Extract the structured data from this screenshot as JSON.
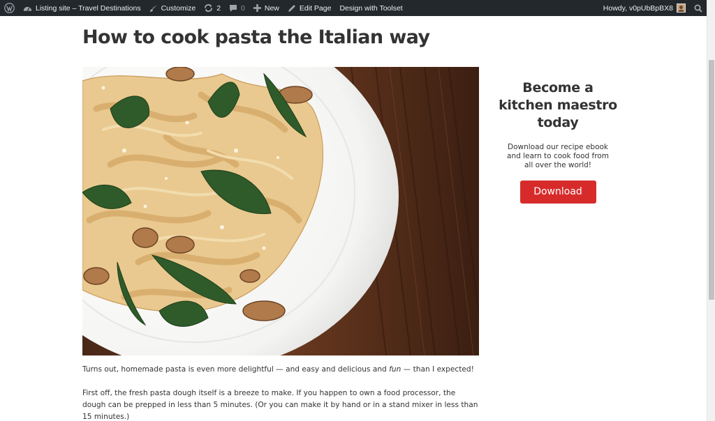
{
  "adminbar": {
    "site_name": "Listing site – Travel Destinations",
    "customize": "Customize",
    "updates_count": "2",
    "comments_count": "0",
    "new_label": "New",
    "edit_page": "Edit Page",
    "toolset": "Design with Toolset",
    "howdy": "Howdy, v0pUbBpBX8"
  },
  "post": {
    "title": "How to cook pasta the Italian way",
    "p1_before": "Turns out, homemade pasta is even more delightful — and easy and delicious and ",
    "p1_em": "fun",
    "p1_after": " — than I expected!",
    "p2": "First off, the fresh pasta dough itself is a breeze to make.  If you happen to own a food processor, the dough can be prepped in less than 5 minutes.  (Or you can make it by hand or in a stand mixer in less than 15 minutes.)"
  },
  "sidebar": {
    "cta_title": "Become a kitchen maestro today",
    "cta_text": "Download our recipe ebook and learn to cook food from all over the world!",
    "button_label": "Download"
  },
  "colors": {
    "adminbar_bg": "#23282d",
    "button_red": "#d72b2b",
    "text": "#333333"
  }
}
